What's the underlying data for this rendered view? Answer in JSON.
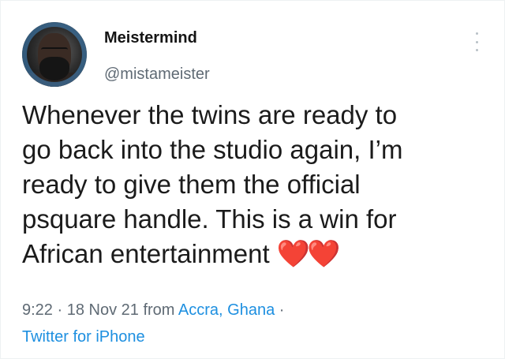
{
  "author": {
    "display_name": "Meistermind",
    "handle": "@mistameister"
  },
  "tweet": {
    "text_lines": [
      "Whenever the twins are ready to",
      "go back into the studio again, I’m",
      "ready to give them the official",
      "psquare handle. This is a win for",
      "African entertainment"
    ],
    "emoji": "❤️❤️"
  },
  "meta": {
    "time": "9:22",
    "sep1": "·",
    "date": "18 Nov 21",
    "from": "from",
    "location": "Accra, Ghana",
    "sep2": "·",
    "source": "Twitter for iPhone"
  },
  "icons": {
    "more": "more-vertical-icon",
    "avatar": "avatar-photo"
  },
  "colors": {
    "link": "#1d8fe0",
    "secondary_text": "#5f6a74",
    "heart": "#e0141e"
  }
}
